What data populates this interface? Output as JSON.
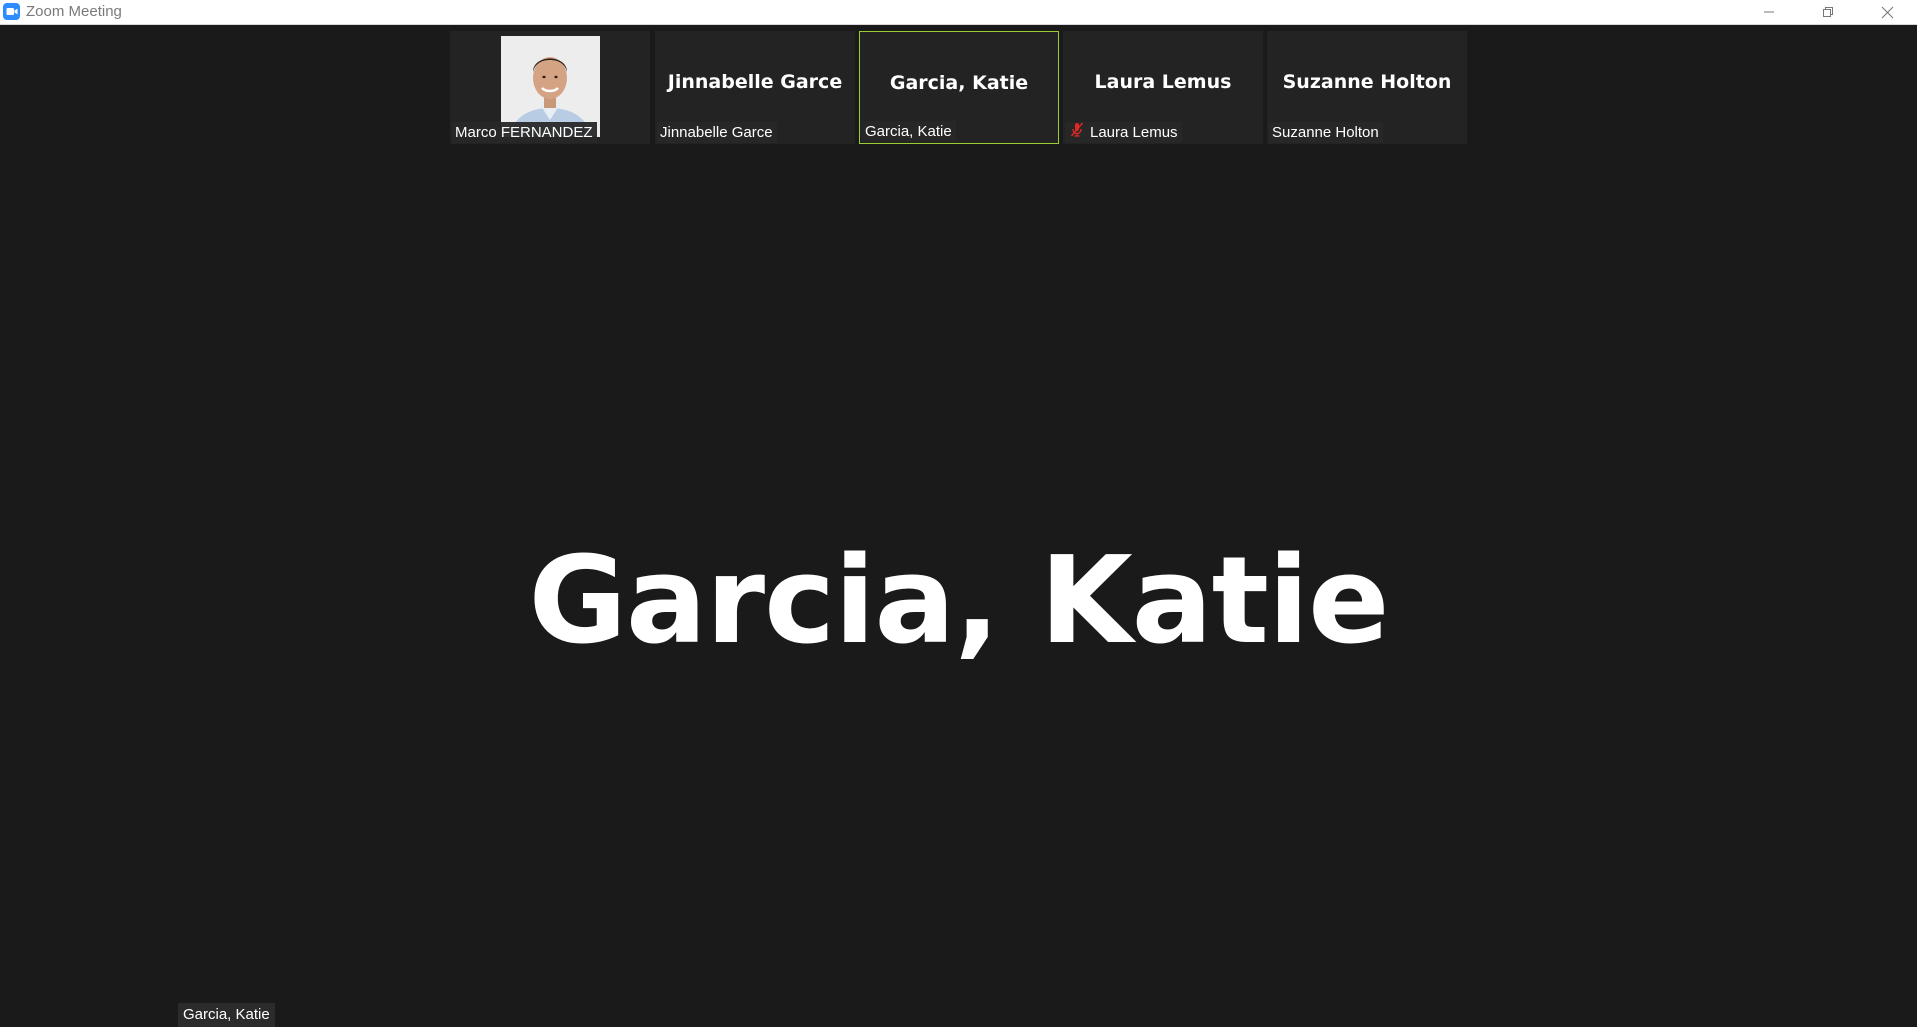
{
  "window": {
    "title": "Zoom Meeting",
    "brand_color": "#2d8cff"
  },
  "participants": [
    {
      "name": "Marco FERNANDEZ",
      "display": "photo",
      "muted": false
    },
    {
      "name": "Jinnabelle Garce",
      "display_name": "Jinnabelle Garce",
      "muted": false
    },
    {
      "name": "Garcia, Katie",
      "display_name": "Garcia, Katie",
      "muted": false,
      "active_speaker": true
    },
    {
      "name": "Laura Lemus",
      "display_name": "Laura Lemus",
      "muted": true
    },
    {
      "name": "Suzanne Holton",
      "display_name": "Suzanne Holton",
      "muted": false
    }
  ],
  "speaker": {
    "main_name": "Garcia, Katie",
    "label": "Garcia, Katie"
  },
  "colors": {
    "active_border": "#9acd32",
    "muted_icon": "#e02828",
    "background": "#1a1a1a"
  },
  "icons": {
    "app": "zoom-camera-icon",
    "mute": "microphone-muted-icon",
    "minimize": "minimize-icon",
    "restore": "restore-icon",
    "close": "close-icon"
  }
}
